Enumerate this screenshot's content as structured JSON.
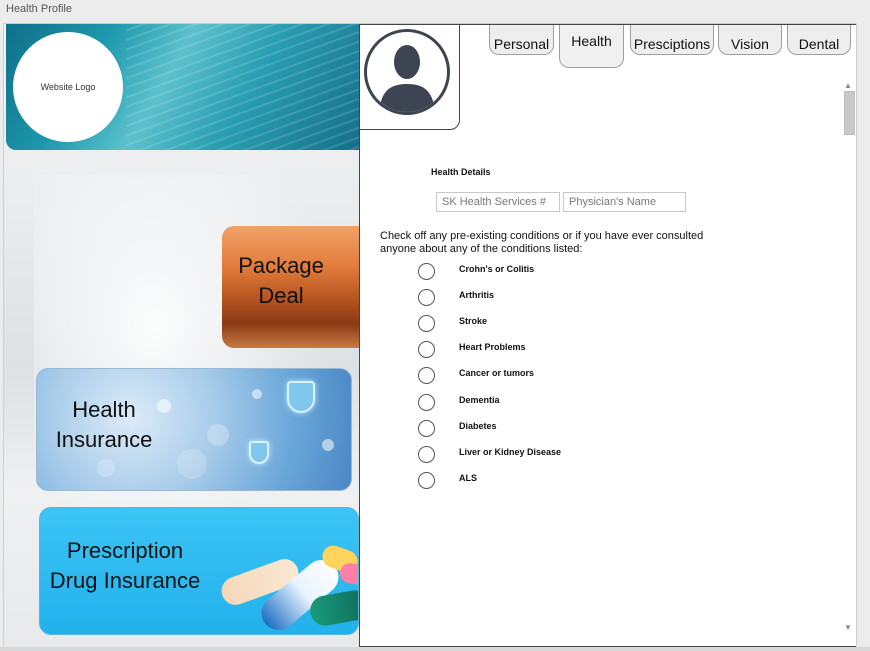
{
  "window": {
    "title": "Health Profile"
  },
  "logo": {
    "text": "Website Logo"
  },
  "cards": {
    "package": {
      "line1": "Package",
      "line2": "Deal"
    },
    "health": {
      "line1": "Health",
      "line2": "Insurance"
    },
    "prescription": {
      "line1": "Prescription",
      "line2": "Drug Insurance"
    }
  },
  "tabs": [
    {
      "label": "Personal"
    },
    {
      "label": "Health",
      "active": true
    },
    {
      "label": "Presciptions"
    },
    {
      "label": "Vision"
    },
    {
      "label": "Dental"
    }
  ],
  "form": {
    "section_title": "Health Details",
    "sk_placeholder": "SK Health Services #",
    "physician_placeholder": "Physician's Name",
    "intro": "Check off any pre-existing conditions or if you have ever consulted anyone about any of the conditions listed:",
    "conditions": [
      {
        "label": "Crohn's or Colitis",
        "checked": false
      },
      {
        "label": "Arthritis",
        "checked": false
      },
      {
        "label": "Stroke",
        "checked": false
      },
      {
        "label": "Heart Problems",
        "checked": false
      },
      {
        "label": "Cancer or tumors",
        "checked": false
      },
      {
        "label": "Dementia",
        "checked": false
      },
      {
        "label": "Diabetes",
        "checked": false
      },
      {
        "label": "Liver or Kidney Disease",
        "checked": false
      },
      {
        "label": "ALS",
        "checked": false
      }
    ]
  },
  "icons": {
    "avatar": "user-silhouette-icon",
    "scroll_up": "chevron-up-icon",
    "scroll_down": "chevron-down-icon"
  }
}
